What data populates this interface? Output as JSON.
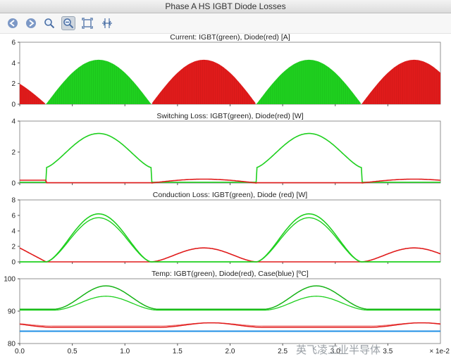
{
  "window": {
    "title": "Phase A HS IGBT Diode Losses"
  },
  "toolbar": {
    "back_icon": "arrow-left-circle-icon",
    "forward_icon": "arrow-right-circle-icon",
    "zoom_icon": "magnifier-icon",
    "zoom_out_icon": "magnifier-minus-icon",
    "fit_icon": "fit-to-window-icon",
    "crosshair_icon": "crosshair-icon"
  },
  "colors": {
    "igbt": "#1fd01f",
    "diode": "#e01b1b",
    "case": "#1f8fe6",
    "axes": "#555555"
  },
  "x_axis": {
    "ticks": [
      "0.0",
      "0.5",
      "1.0",
      "1.5",
      "2.0",
      "2.5",
      "3.0",
      "3.5"
    ],
    "multiplier": "× 1e-2",
    "range": [
      0,
      0.04
    ]
  },
  "watermark": "英飞凌工业半导体",
  "chart_data": [
    {
      "type": "area",
      "title": "Current: IGBT(green), Diode(red) [A]",
      "ylim": [
        0,
        6
      ],
      "yticks": [
        "0",
        "2",
        "4",
        "6"
      ],
      "series": [
        {
          "name": "IGBT",
          "values": "0 at 0.0025 and 0.0125 s; peak 4.3 A at 0.0073 s; repeats at 0.0225–0.0325 s"
        },
        {
          "name": "Diode",
          "values": "peak 4.3 A at 0.0173 s and 0.0373 s; 2.8 A at 0 s"
        }
      ]
    },
    {
      "type": "line",
      "title": "Switching Loss: IGBT(green), Diode(red) [W]",
      "ylim": [
        0,
        4
      ],
      "yticks": [
        "0",
        "2",
        "4"
      ],
      "series": [
        {
          "name": "IGBT",
          "peak": 3.2,
          "peak_x": 0.0073,
          "edge_value": 1.0
        },
        {
          "name": "Diode",
          "peak": 0.25,
          "peak_x": 0.0173
        }
      ]
    },
    {
      "type": "line",
      "title": "Conduction Loss: IGBT(green), Diode (red) [W]",
      "ylim": [
        0,
        8
      ],
      "yticks": [
        "0",
        "2",
        "4",
        "6",
        "8"
      ],
      "series": [
        {
          "name": "IGBT",
          "peak": 6.2,
          "peak_x": 0.0073
        },
        {
          "name": "Diode",
          "peak": 1.8,
          "peak_x": 0.0173,
          "first_value": 1.8
        }
      ]
    },
    {
      "type": "line",
      "title": "Temp: IGBT(green), Diode(red), Case(blue) [ºC]",
      "ylim": [
        80,
        100
      ],
      "yticks": [
        "80",
        "90",
        "100"
      ],
      "series": [
        {
          "name": "IGBT",
          "min": 90.6,
          "max": 97.8,
          "peak_x": 0.008
        },
        {
          "name": "Diode",
          "min": 85.0,
          "max": 86.4,
          "peak_x": 0.0195
        },
        {
          "name": "Case",
          "value": 83.8
        }
      ]
    }
  ]
}
